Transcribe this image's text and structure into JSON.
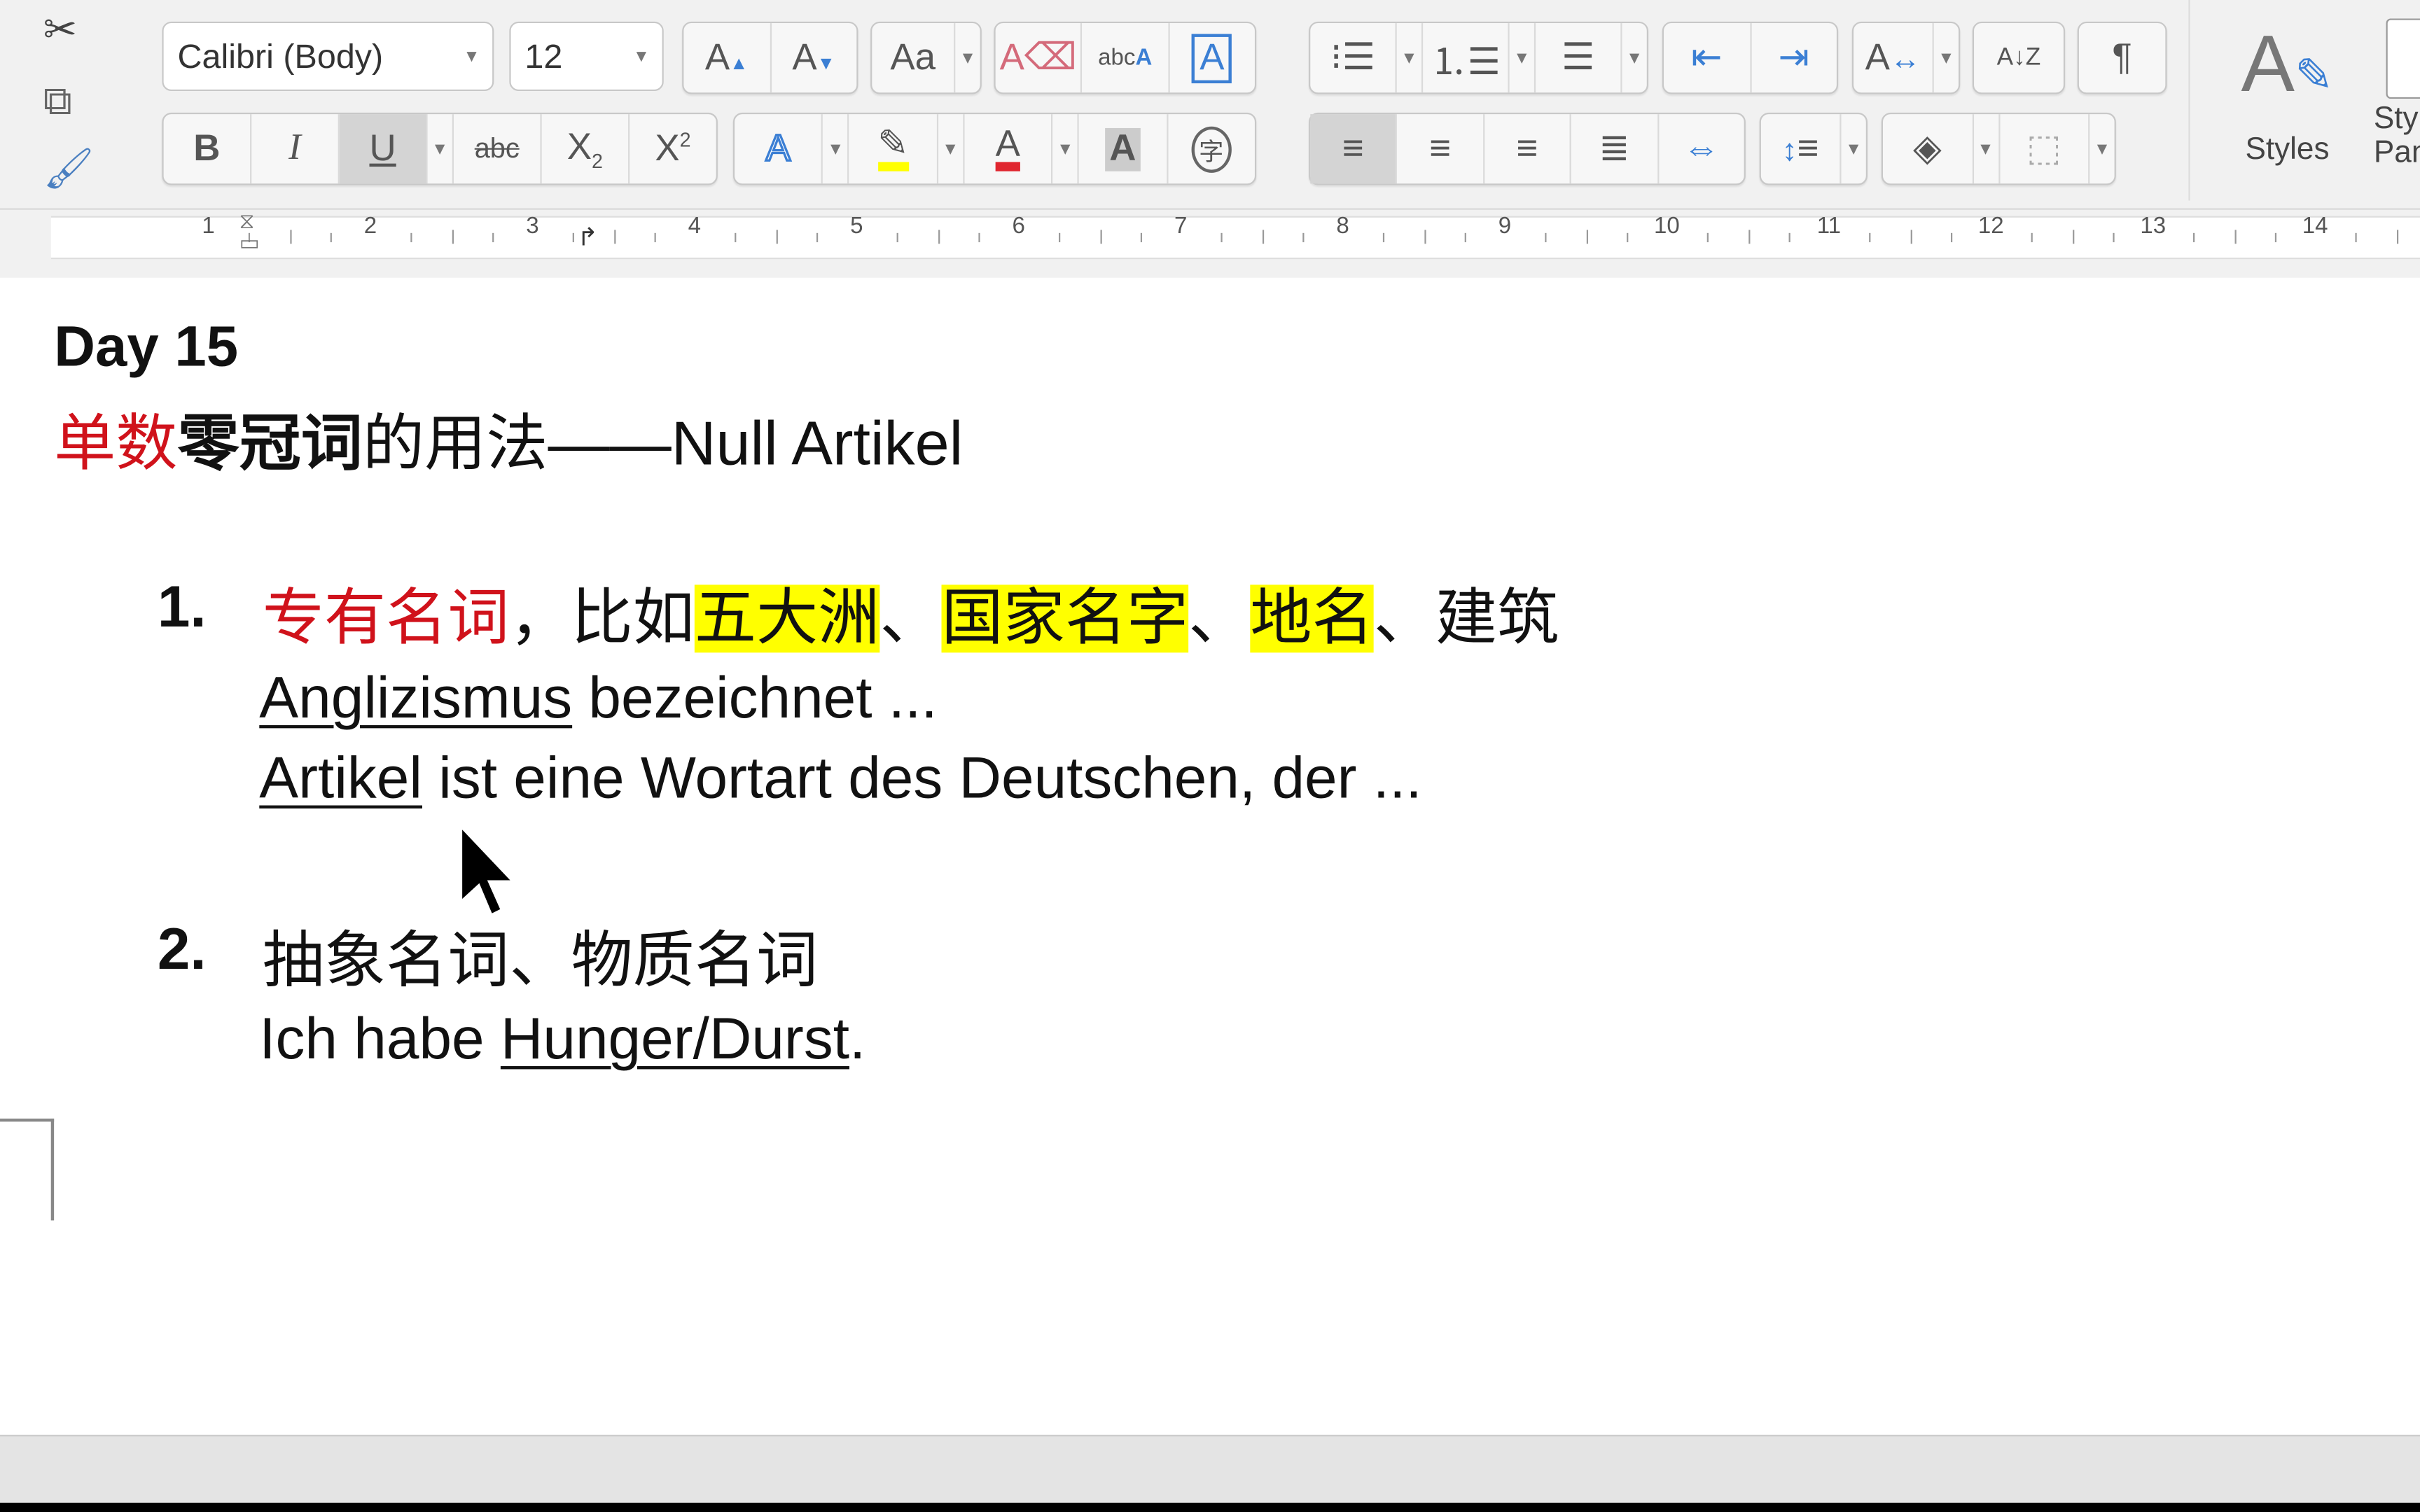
{
  "toolbar": {
    "font_name": "Calibri (Body)",
    "font_size": "12",
    "styles_label": "Styles",
    "styles_pane_label": "Styles Pane",
    "left_icons": [
      "scissors-icon",
      "copy-icon",
      "format-painter-icon"
    ],
    "row1": [
      {
        "name": "grow-font-button",
        "glyph": "A▴"
      },
      {
        "name": "shrink-font-button",
        "glyph": "A▾"
      },
      {
        "name": "change-case-button",
        "glyph": "Aa"
      },
      {
        "name": "clear-formatting-button",
        "glyph": "A⌫"
      },
      {
        "name": "phonetic-guide-button",
        "glyph": "abc"
      },
      {
        "name": "character-border-button",
        "glyph": "A"
      },
      {
        "name": "bullets-button",
        "glyph": "☰"
      },
      {
        "name": "numbering-button",
        "glyph": "☰"
      },
      {
        "name": "multilevel-list-button",
        "glyph": "☰"
      },
      {
        "name": "decrease-indent-button",
        "glyph": "⇤"
      },
      {
        "name": "increase-indent-button",
        "glyph": "⇥"
      },
      {
        "name": "text-direction-button",
        "glyph": "A↔"
      },
      {
        "name": "sort-button",
        "glyph": "A↓"
      },
      {
        "name": "show-formatting-button",
        "glyph": "¶"
      }
    ],
    "row2": [
      {
        "name": "bold-button",
        "glyph": "B"
      },
      {
        "name": "italic-button",
        "glyph": "I"
      },
      {
        "name": "underline-button",
        "glyph": "U"
      },
      {
        "name": "strikethrough-button",
        "glyph": "abc"
      },
      {
        "name": "subscript-button",
        "glyph": "X₂"
      },
      {
        "name": "superscript-button",
        "glyph": "X²"
      },
      {
        "name": "text-effects-button",
        "glyph": "A"
      },
      {
        "name": "highlight-button",
        "glyph": "✎"
      },
      {
        "name": "font-color-button",
        "glyph": "A"
      },
      {
        "name": "character-shading-button",
        "glyph": "A"
      },
      {
        "name": "enclose-characters-button",
        "glyph": "㊢"
      },
      {
        "name": "align-left-button",
        "glyph": "≡"
      },
      {
        "name": "center-button",
        "glyph": "≡"
      },
      {
        "name": "align-right-button",
        "glyph": "≡"
      },
      {
        "name": "justify-button",
        "glyph": "≡"
      },
      {
        "name": "distributed-button",
        "glyph": "⇔"
      },
      {
        "name": "line-spacing-button",
        "glyph": "↕≡"
      },
      {
        "name": "shading-button",
        "glyph": "◈"
      },
      {
        "name": "borders-button",
        "glyph": "⬚"
      }
    ],
    "colors": {
      "highlight": "#ffff00",
      "font_color": "#e0262f",
      "icon_blue": "#3b7fd4"
    }
  },
  "ruler": {
    "numbers": [
      "1",
      "2",
      "3",
      "4",
      "5",
      "6",
      "7",
      "8",
      "9",
      "10",
      "11",
      "12",
      "13",
      "14"
    ]
  },
  "document": {
    "heading": "Day 15",
    "subtitle": {
      "red": "单数",
      "bold": "零冠词",
      "rest": "的用法——Null Artikel"
    },
    "items": [
      {
        "number": "1.",
        "line": {
          "red": "专有名词",
          "sep1": "，比如",
          "hl1": "五大洲",
          "sep2": "、",
          "hl2": "国家名字",
          "sep3": "、",
          "hl3": "地名",
          "rest": "、建筑"
        },
        "examples": [
          {
            "underlined": "Anglizismus",
            "rest": " bezeichnet ..."
          },
          {
            "underlined": "Artikel",
            "rest": " ist eine Wortart des Deutschen, der ..."
          }
        ]
      },
      {
        "number": "2.",
        "line": {
          "text": "抽象名词、物质名词"
        },
        "examples": [
          {
            "before": "Ich habe ",
            "underlined": "Hunger/Durst",
            "rest": "."
          }
        ]
      }
    ],
    "colors": {
      "red": "#d0121b",
      "highlight": "#ffff00"
    }
  }
}
